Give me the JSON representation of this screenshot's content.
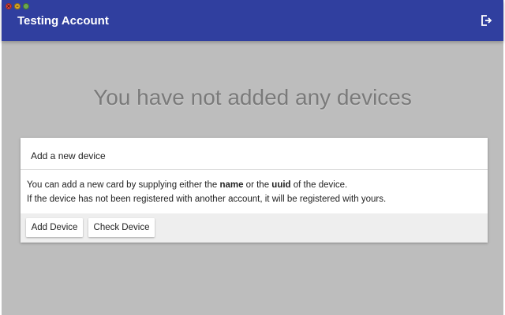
{
  "header": {
    "title": "Testing Account",
    "logout_icon": "logout-icon"
  },
  "window_controls": [
    "close",
    "minimize",
    "maximize"
  ],
  "main": {
    "empty_message": "You have not added any devices"
  },
  "card": {
    "title": "Add a new device",
    "line1_part1": "You can add a new card by supplying either the ",
    "line1_bold1": "name",
    "line1_part2": " or the ",
    "line1_bold2": "uuid",
    "line1_part3": " of the device.",
    "line2": "If the device has not been registered with another account, it will be registered with yours.",
    "add_button": "Add Device",
    "check_button": "Check Device"
  },
  "colors": {
    "header": "#303f9f",
    "background": "#bdbdbd",
    "card": "#ffffff",
    "actions": "#eeeeee"
  }
}
